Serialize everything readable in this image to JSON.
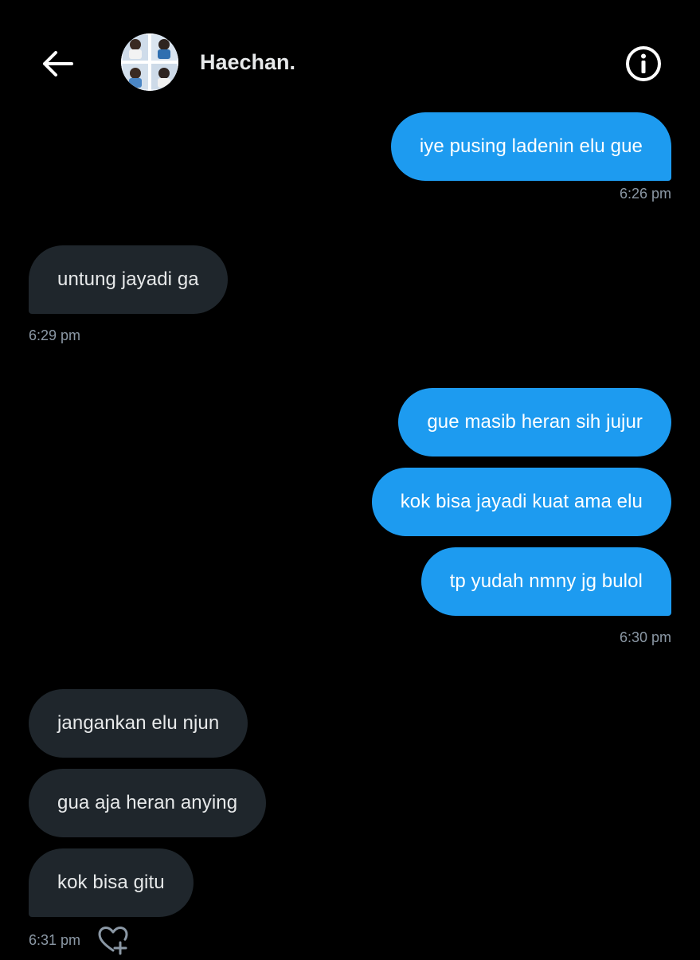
{
  "header": {
    "back_icon": "arrow-left-icon",
    "contact_name": "Haechan.",
    "info_icon": "info-circle-icon"
  },
  "colors": {
    "background": "#000000",
    "sent_bubble": "#1d9bf0",
    "received_bubble": "#1f262c",
    "timestamp": "#8b98a5"
  },
  "messages": [
    {
      "side": "sent",
      "text": "iye pusing ladenin elu gue"
    },
    {
      "side": "received",
      "text": "untung jayadi ga"
    },
    {
      "side": "sent",
      "text": "gue masib heran sih jujur"
    },
    {
      "side": "sent",
      "text": "kok bisa jayadi kuat ama elu"
    },
    {
      "side": "sent",
      "text": "tp yudah nmny jg bulol"
    },
    {
      "side": "received",
      "text": "jangankan elu njun"
    },
    {
      "side": "received",
      "text": "gua aja heran anying"
    },
    {
      "side": "received",
      "text": "kok bisa gitu"
    }
  ],
  "timestamps": [
    "6:26 pm",
    "6:29 pm",
    "6:30 pm",
    "6:31 pm"
  ],
  "reaction_icon": "heart-plus-icon"
}
